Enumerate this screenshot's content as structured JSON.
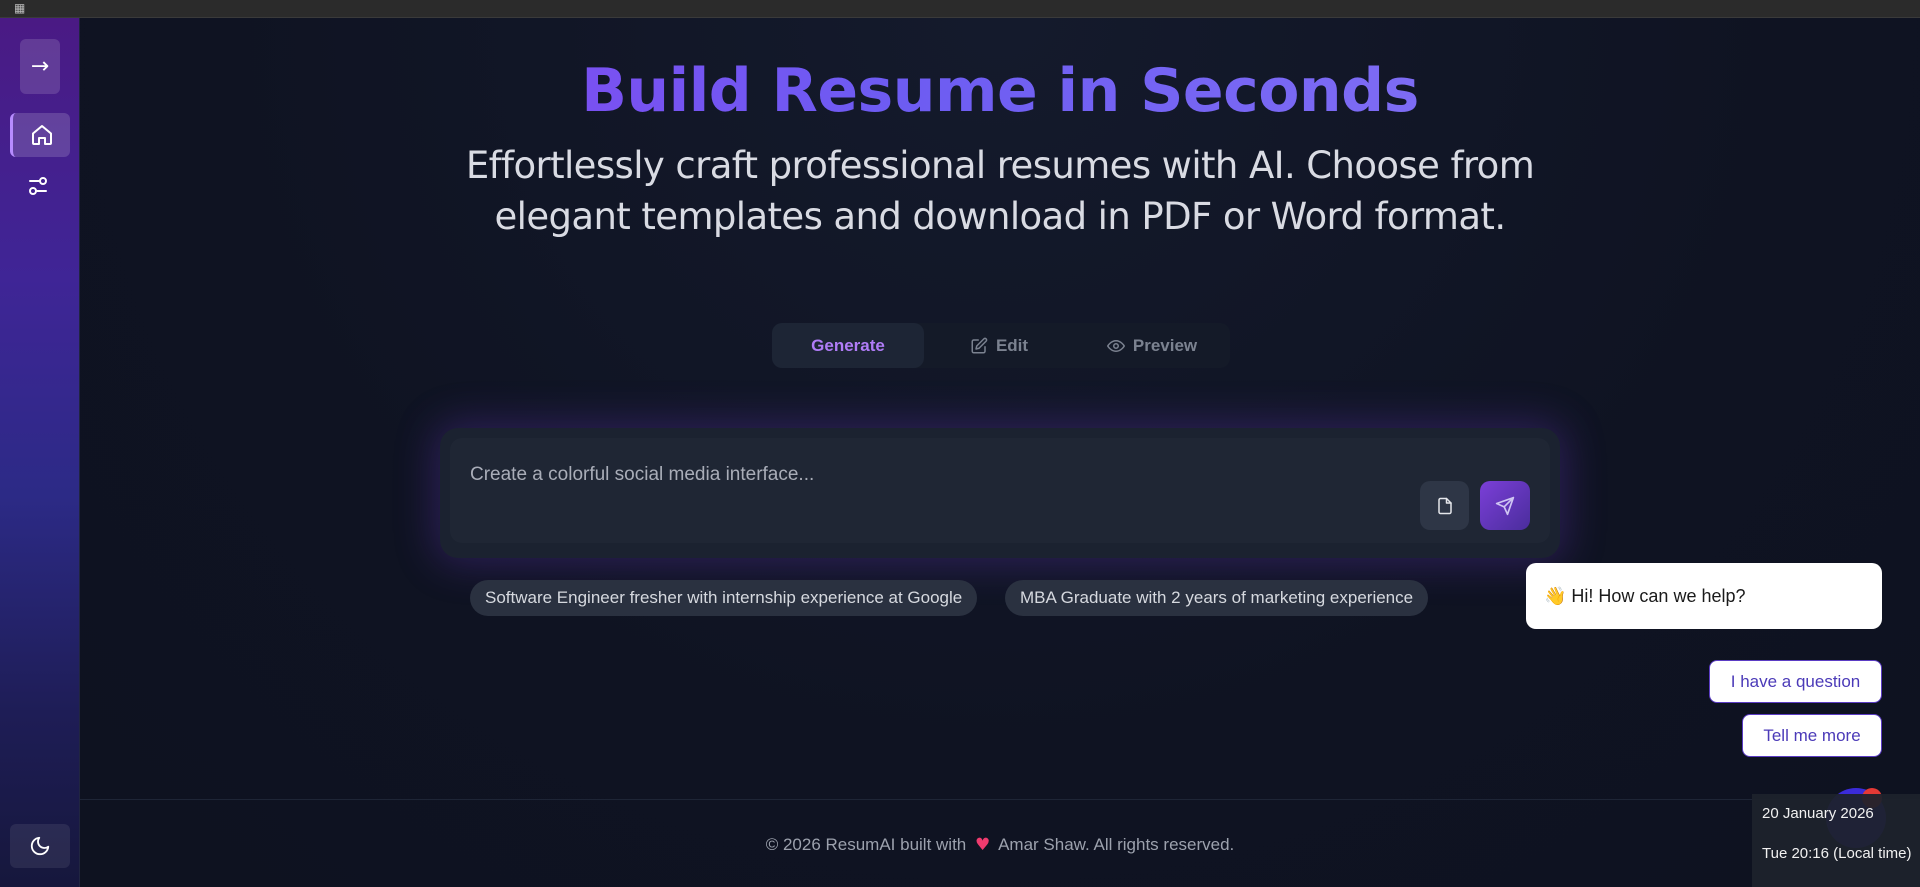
{
  "sidebar": {
    "expand_label": "→"
  },
  "hero": {
    "title": "Build Resume in Seconds",
    "subtitle": "Effortlessly craft professional resumes with AI. Choose from elegant templates and download in PDF or Word format."
  },
  "tabs": [
    {
      "label": "Generate",
      "active": true
    },
    {
      "label": "Edit",
      "icon": "edit-icon"
    },
    {
      "label": "Preview",
      "icon": "eye-icon"
    }
  ],
  "prompt": {
    "placeholder": "Create a colorful social media interface..."
  },
  "suggestions": [
    "Software Engineer fresher with internship experience at Google",
    "MBA Graduate with 2 years of marketing experience"
  ],
  "footer": {
    "prefix": "© 2026 ResumAI built with",
    "heart": "♥",
    "suffix": "Amar Shaw. All rights reserved."
  },
  "chat_widget": {
    "greeting": "👋 Hi! How can we help?",
    "quick_replies": [
      "I have a question",
      "Tell me more"
    ]
  },
  "taskbar_clock": {
    "date": "20 January 2026",
    "time": "Tue 20:16 (Local time)"
  },
  "colors": {
    "accent": "#8b3ff0",
    "accent_secondary": "#6d5cf2",
    "background": "#0f1322",
    "heart": "#ef3b6e"
  }
}
